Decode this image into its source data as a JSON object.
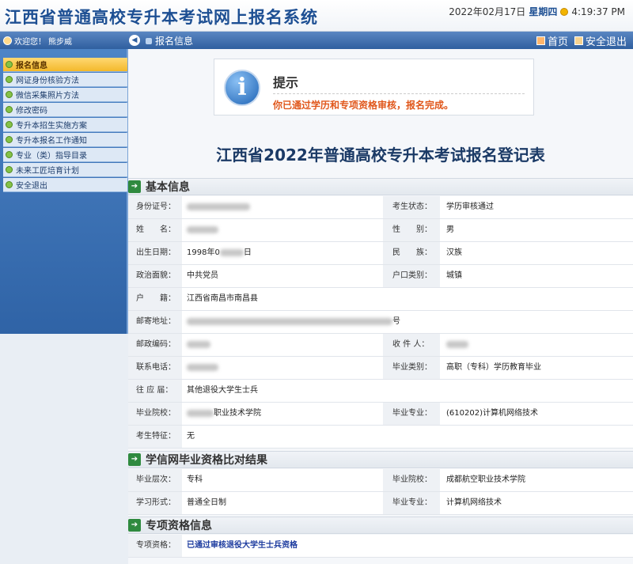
{
  "header": {
    "title": "江西省普通高校专升本考试网上报名系统",
    "date": "2022年02月17日",
    "weekday": "星期四",
    "time": "4:19:37 PM"
  },
  "navbar": {
    "welcome": "欢迎您！",
    "username": "熊步威",
    "breadcrumb": "报名信息",
    "home": "首页",
    "logout": "安全退出"
  },
  "sidebar": {
    "items": [
      {
        "label": "报名信息"
      },
      {
        "label": "网证身份核验方法"
      },
      {
        "label": "微信采集照片方法"
      },
      {
        "label": "修改密码"
      },
      {
        "label": "专升本招生实施方案"
      },
      {
        "label": "专升本报名工作通知"
      },
      {
        "label": "专业（类）指导目录"
      },
      {
        "label": "未来工匠培育计划"
      },
      {
        "label": "安全退出"
      }
    ]
  },
  "notice": {
    "title": "提示",
    "message": "你已通过学历和专项资格审核，报名完成。"
  },
  "form": {
    "title": "江西省2022年普通高校专升本考试报名登记表",
    "sections": {
      "basic": "基本信息",
      "chsi": "学信网毕业资格比对结果",
      "special": "专项资格信息"
    },
    "basic": {
      "id_label": "身份证号：",
      "status_label": "考生状态：",
      "status_value": "学历审核通过",
      "name_label": "姓　　名：",
      "gender_label": "性　　别：",
      "gender_value": "男",
      "birth_label": "出生日期：",
      "birth_value": "1998年0",
      "birth_suffix": "日",
      "ethnic_label": "民　　族：",
      "ethnic_value": "汉族",
      "political_label": "政治面貌：",
      "political_value": "中共党员",
      "hukou_type_label": "户口类别：",
      "hukou_type_value": "城镇",
      "hukou_label": "户　　籍：",
      "hukou_value": "江西省南昌市南昌县",
      "address_label": "邮寄地址：",
      "address_suffix": "号",
      "postcode_label": "邮政编码：",
      "receiver_label": "收 件 人：",
      "phone_label": "联系电话：",
      "grad_type_label": "毕业类别：",
      "grad_type_value": "高职（专科）学历教育毕业",
      "prev_label": "往 应 届：",
      "prev_value": "其他退役大学生士兵",
      "school_label": "毕业院校：",
      "school_value": "职业技术学院",
      "major_label": "毕业专业：",
      "major_value": "(610202)计算机网络技术",
      "feature_label": "考生特征：",
      "feature_value": "无"
    },
    "chsi": {
      "level_label": "毕业层次：",
      "level_value": "专科",
      "school_label": "毕业院校：",
      "school_value": "成都航空职业技术学院",
      "mode_label": "学习形式：",
      "mode_value": "普通全日制",
      "major_label": "毕业专业：",
      "major_value": "计算机网络技术"
    },
    "special": {
      "qual_label": "专项资格：",
      "qual_value": "已通过审核退役大学生士兵资格"
    }
  }
}
